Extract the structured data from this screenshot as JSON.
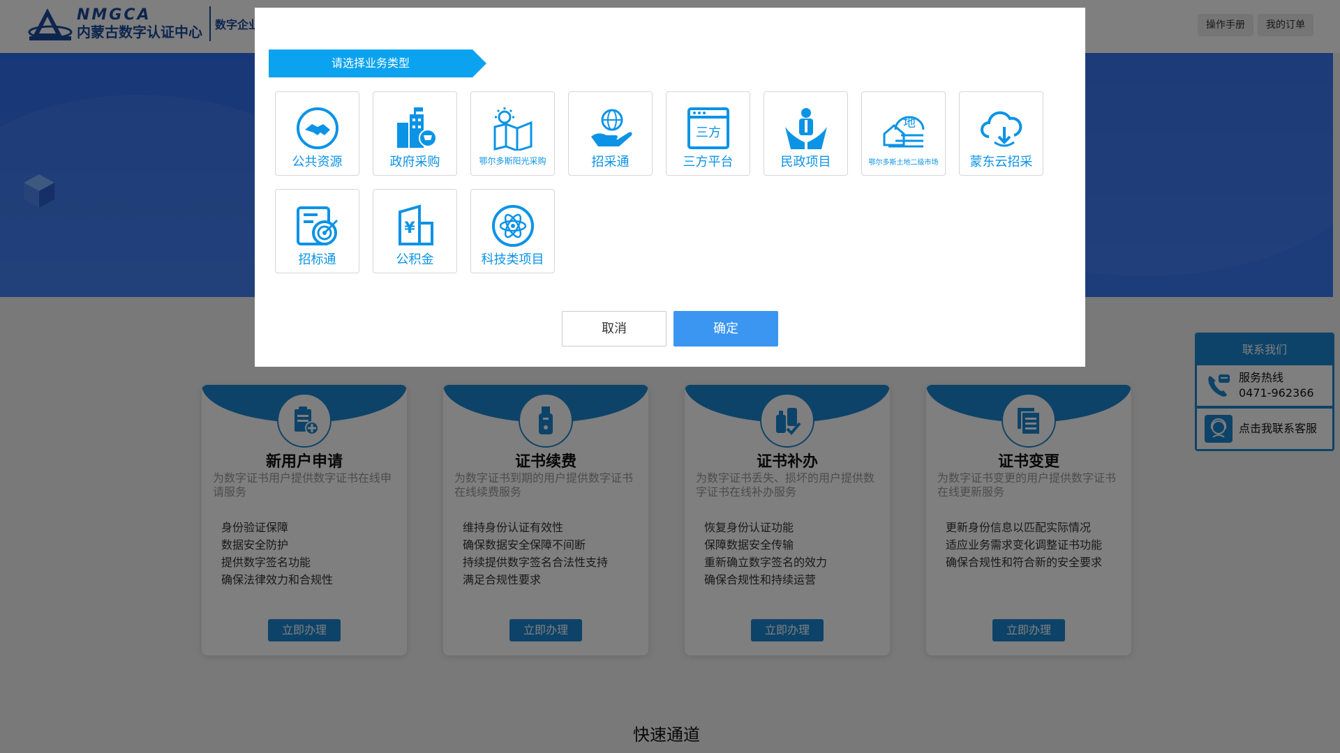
{
  "header": {
    "logo_en": "NMGCA",
    "logo_cn": "内蒙古数字认证中心",
    "logo_sub": "数字企业",
    "manual_button": "操作手册",
    "orders_button": "我的订单"
  },
  "cards": [
    {
      "title": "新用户申请",
      "desc": "为数字证书用户提供数字证书在线申请服务",
      "items": [
        "身份验证保障",
        "数据安全防护",
        "提供数字签名功能",
        "确保法律效力和合规性"
      ],
      "button": "立即办理",
      "icon": "clipboard-add-icon"
    },
    {
      "title": "证书续费",
      "desc": "为数字证书到期的用户提供数字证书在线续费服务",
      "items": [
        "维持身份认证有效性",
        "确保数据安全保障不间断",
        "持续提供数字签名合法性支持",
        "满足合规性要求"
      ],
      "button": "立即办理",
      "icon": "usb-key-icon"
    },
    {
      "title": "证书补办",
      "desc": "为数字证书丢失、损坏的用户提供数字证书在线补办服务",
      "items": [
        "恢复身份认证功能",
        "保障数据安全传输",
        "重新确立数字签名的效力",
        "确保合规性和持续运营"
      ],
      "button": "立即办理",
      "icon": "key-check-icon"
    },
    {
      "title": "证书变更",
      "desc": "为数字证书变更的用户提供数字证书在线更新服务",
      "items": [
        "更新身份信息以匹配实际情况",
        "适应业务需求变化调整证书功能",
        "确保合规性和符合新的安全要求"
      ],
      "button": "立即办理",
      "icon": "documents-icon"
    }
  ],
  "quick_title": "快速通道",
  "contact": {
    "title": "联系我们",
    "hotline_label": "服务热线",
    "hotline_number": "0471-962366",
    "service_label": "点击我联系客服"
  },
  "modal": {
    "heading": "请选择业务类型",
    "tiles": [
      {
        "label": "公共资源",
        "icon": "handshake-icon"
      },
      {
        "label": "政府采购",
        "icon": "government-building-icon"
      },
      {
        "label": "鄂尔多斯阳光采购",
        "icon": "sun-map-icon"
      },
      {
        "label": "招采通",
        "icon": "globe-hand-icon"
      },
      {
        "label": "三方平台",
        "icon": "platform-window-icon"
      },
      {
        "label": "民政项目",
        "icon": "people-hands-icon"
      },
      {
        "label": "鄂尔多斯土地二级市场",
        "icon": "land-house-icon"
      },
      {
        "label": "蒙东云招采",
        "icon": "cloud-download-icon"
      },
      {
        "label": "招标通",
        "icon": "target-document-icon"
      },
      {
        "label": "公积金",
        "icon": "yuan-building-icon"
      },
      {
        "label": "科技类项目",
        "icon": "atom-icon"
      }
    ],
    "cancel": "取消",
    "confirm": "确定"
  },
  "colors": {
    "brand_blue": "#1a86d0",
    "modal_accent": "#0ba3f0",
    "confirm_blue": "#3a96f0",
    "banner_blue": "#2f6ff0"
  }
}
